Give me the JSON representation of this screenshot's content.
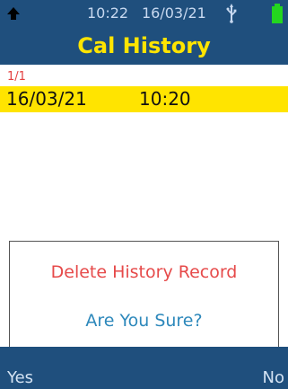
{
  "status": {
    "time": "10:22",
    "date": "16/03/21",
    "left_icon": "up-arrow-icon",
    "usb_icon": "usb-icon",
    "battery_icon": "battery-icon"
  },
  "header": {
    "title": "Cal History"
  },
  "pagination": {
    "text": "1/1"
  },
  "records": [
    {
      "date": "16/03/21",
      "time": "10:20"
    }
  ],
  "dialog": {
    "title": "Delete History Record",
    "question": "Are You Sure?"
  },
  "footer": {
    "left_label": "Yes",
    "right_label": "No"
  },
  "colors": {
    "header_bg": "#1f4f7d",
    "title": "#ffe400",
    "row_highlight": "#ffe400",
    "dialog_title": "#e64a4a",
    "dialog_question": "#2d88bb",
    "battery": "#24d61f"
  }
}
